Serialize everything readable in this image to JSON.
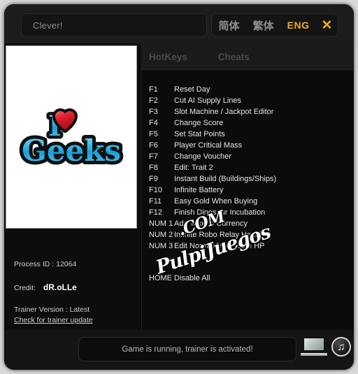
{
  "window": {
    "game_title": "Clever!",
    "game_title_placeholder": "Clever!"
  },
  "languages": {
    "simplified": "简体",
    "traditional": "繁体",
    "english": "ENG",
    "close": "✕",
    "active_color": "#f0a91e"
  },
  "cover": {
    "line1": "I",
    "heart": "♥",
    "line2": "Geeks",
    "text_color": "#29b6e8",
    "heart_color": "#e8313b",
    "outline_color": "#101010",
    "background": "#ffffff"
  },
  "info": {
    "process_id_label": "Process ID :",
    "process_id_value": "12064",
    "credit_label": "Credit:",
    "credit_value": "dR.oLLe",
    "trainer_version_label": "Trainer Version :",
    "trainer_version_value": "Latest",
    "update_link": "Check for trainer update"
  },
  "tabs": [
    {
      "label": "HotKeys"
    },
    {
      "label": "Cheats"
    }
  ],
  "hotkeys": [
    {
      "key": "F1",
      "label": "Reset Day"
    },
    {
      "key": "F2",
      "label": "Cut AI Supply Lines"
    },
    {
      "key": "F3",
      "label": "Slot Machine / Jackpot Editor"
    },
    {
      "key": "F4",
      "label": "Change Score"
    },
    {
      "key": "F5",
      "label": "Set Stat Points"
    },
    {
      "key": "F6",
      "label": "Player Critical Mass"
    },
    {
      "key": "F7",
      "label": "Change Voucher"
    },
    {
      "key": "F8",
      "label": "Edit: Trait 2"
    },
    {
      "key": "F9",
      "label": "Instant Build (Buildings/Ships)"
    },
    {
      "key": "F10",
      "label": "Infinite Battery"
    },
    {
      "key": "F11",
      "label": "Easy Gold When Buying"
    },
    {
      "key": "F12",
      "label": "Finish Dinosaur Incubation"
    },
    {
      "key": "NUM 1",
      "label": "Add Tokens Currency"
    },
    {
      "key": "NUM 2",
      "label": "Infinite Robo Relay Health"
    },
    {
      "key": "NUM 3",
      "label": "Edit Normal Max Team HP"
    }
  ],
  "disable_all": "HOME Disable All",
  "watermark": {
    "line1": "PulpiJuegos",
    "line2": ".COM"
  },
  "status": {
    "message": "Game is running, trainer is activated!",
    "music_glyph": "♫"
  }
}
